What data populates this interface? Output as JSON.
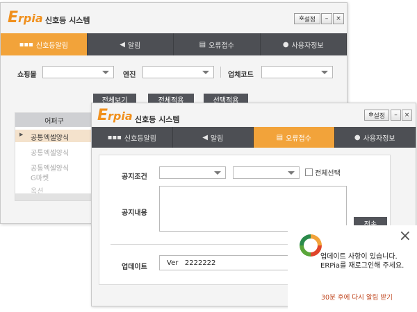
{
  "app": {
    "logo_letter": "E",
    "logo_rest": "rpia",
    "title": "신호등 시스템",
    "settings_label": "설정",
    "minimize_label": "–",
    "close_label": "×"
  },
  "tabs": [
    {
      "label": "신호등알림",
      "icon": "traffic-light-icon"
    },
    {
      "label": "알림",
      "icon": "megaphone-icon"
    },
    {
      "label": "오류접수",
      "icon": "list-icon"
    },
    {
      "label": "사용자정보",
      "icon": "user-icon"
    }
  ],
  "back_window": {
    "mall_label": "쇼핑몰",
    "engine_label": "엔진",
    "vendor_label": "업체코드",
    "buttons": [
      "전체보기",
      "전체적용",
      "선택적용"
    ],
    "list_header": "어퍼구",
    "list_items": [
      "공통엑셀양식",
      "공통엑셀양식",
      "공통엑셀양식",
      "G마켓",
      "옥션"
    ]
  },
  "front_window": {
    "condition_label": "공지조건",
    "select_all_label": "전체선택",
    "content_label": "공지내용",
    "send_label": "전송",
    "update_label": "업데이트",
    "version_prefix": "Ver",
    "version_value": "2222222"
  },
  "notification": {
    "line1": "업데이트 사항이 있습니다.",
    "line2": "ERPia를 재로그인해 주세요.",
    "remind_label": "30분 후에 다시 알림 받기",
    "close_label": "×"
  },
  "colors": {
    "accent": "#f2a33a",
    "tabbar": "#4d4f54",
    "logo": "#f0901d",
    "remind": "#c0461e"
  }
}
